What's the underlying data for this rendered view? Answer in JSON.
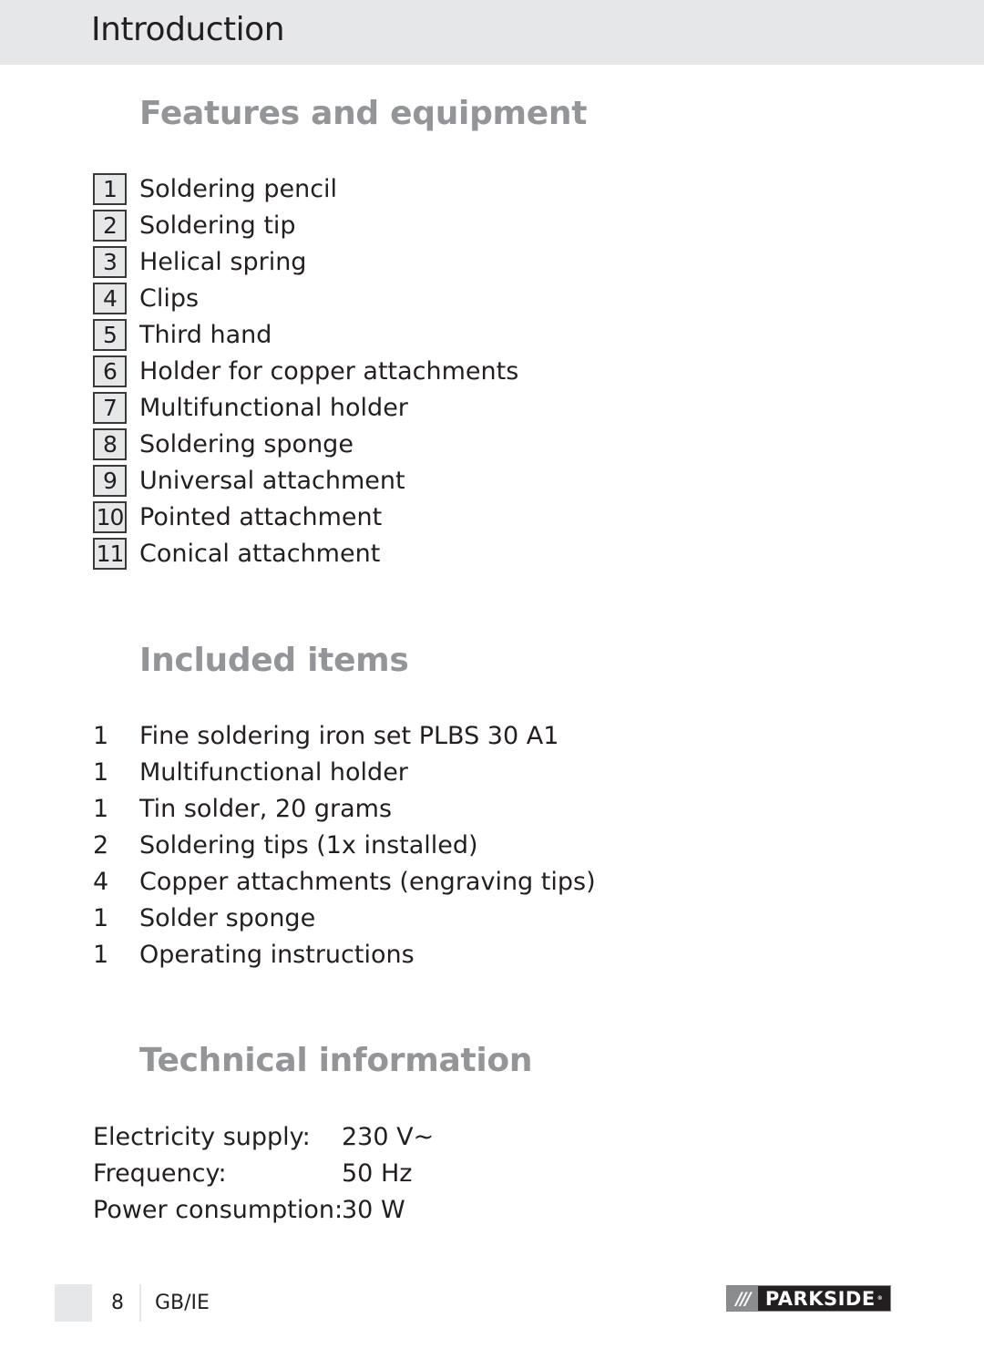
{
  "header": {
    "title": "Introduction"
  },
  "features": {
    "heading": "Features and equipment",
    "items": [
      {
        "num": "1",
        "label": "Soldering pencil"
      },
      {
        "num": "2",
        "label": "Soldering tip"
      },
      {
        "num": "3",
        "label": "Helical spring"
      },
      {
        "num": "4",
        "label": "Clips"
      },
      {
        "num": "5",
        "label": "Third hand"
      },
      {
        "num": "6",
        "label": "Holder for copper attachments"
      },
      {
        "num": "7",
        "label": "Multifunctional holder"
      },
      {
        "num": "8",
        "label": "Soldering sponge"
      },
      {
        "num": "9",
        "label": "Universal attachment"
      },
      {
        "num": "10",
        "label": "Pointed attachment"
      },
      {
        "num": "11",
        "label": "Conical attachment"
      }
    ]
  },
  "included": {
    "heading": "Included items",
    "items": [
      {
        "qty": "1",
        "label": "Fine soldering iron set PLBS 30 A1"
      },
      {
        "qty": "1",
        "label": "Multifunctional holder"
      },
      {
        "qty": "1",
        "label": "Tin solder, 20 grams"
      },
      {
        "qty": "2",
        "label": "Soldering tips (1x installed)"
      },
      {
        "qty": "4",
        "label": "Copper attachments (engraving tips)"
      },
      {
        "qty": "1",
        "label": "Solder sponge"
      },
      {
        "qty": "1",
        "label": "Operating instructions"
      }
    ]
  },
  "technical": {
    "heading": "Technical information",
    "rows": [
      {
        "label": "Electricity supply:",
        "value": "230 V~"
      },
      {
        "label": "Frequency:",
        "value": "50 Hz"
      },
      {
        "label": "Power consumption:",
        "value": "30 W"
      }
    ]
  },
  "footer": {
    "page_number": "8",
    "locale": "GB/IE",
    "brand": {
      "stripes": "///",
      "name": "PARKSIDE",
      "reg": "®"
    }
  },
  "colors": {
    "heading_gray": "#939598",
    "band_gray": "#e6e7e8",
    "text": "#231f20"
  }
}
